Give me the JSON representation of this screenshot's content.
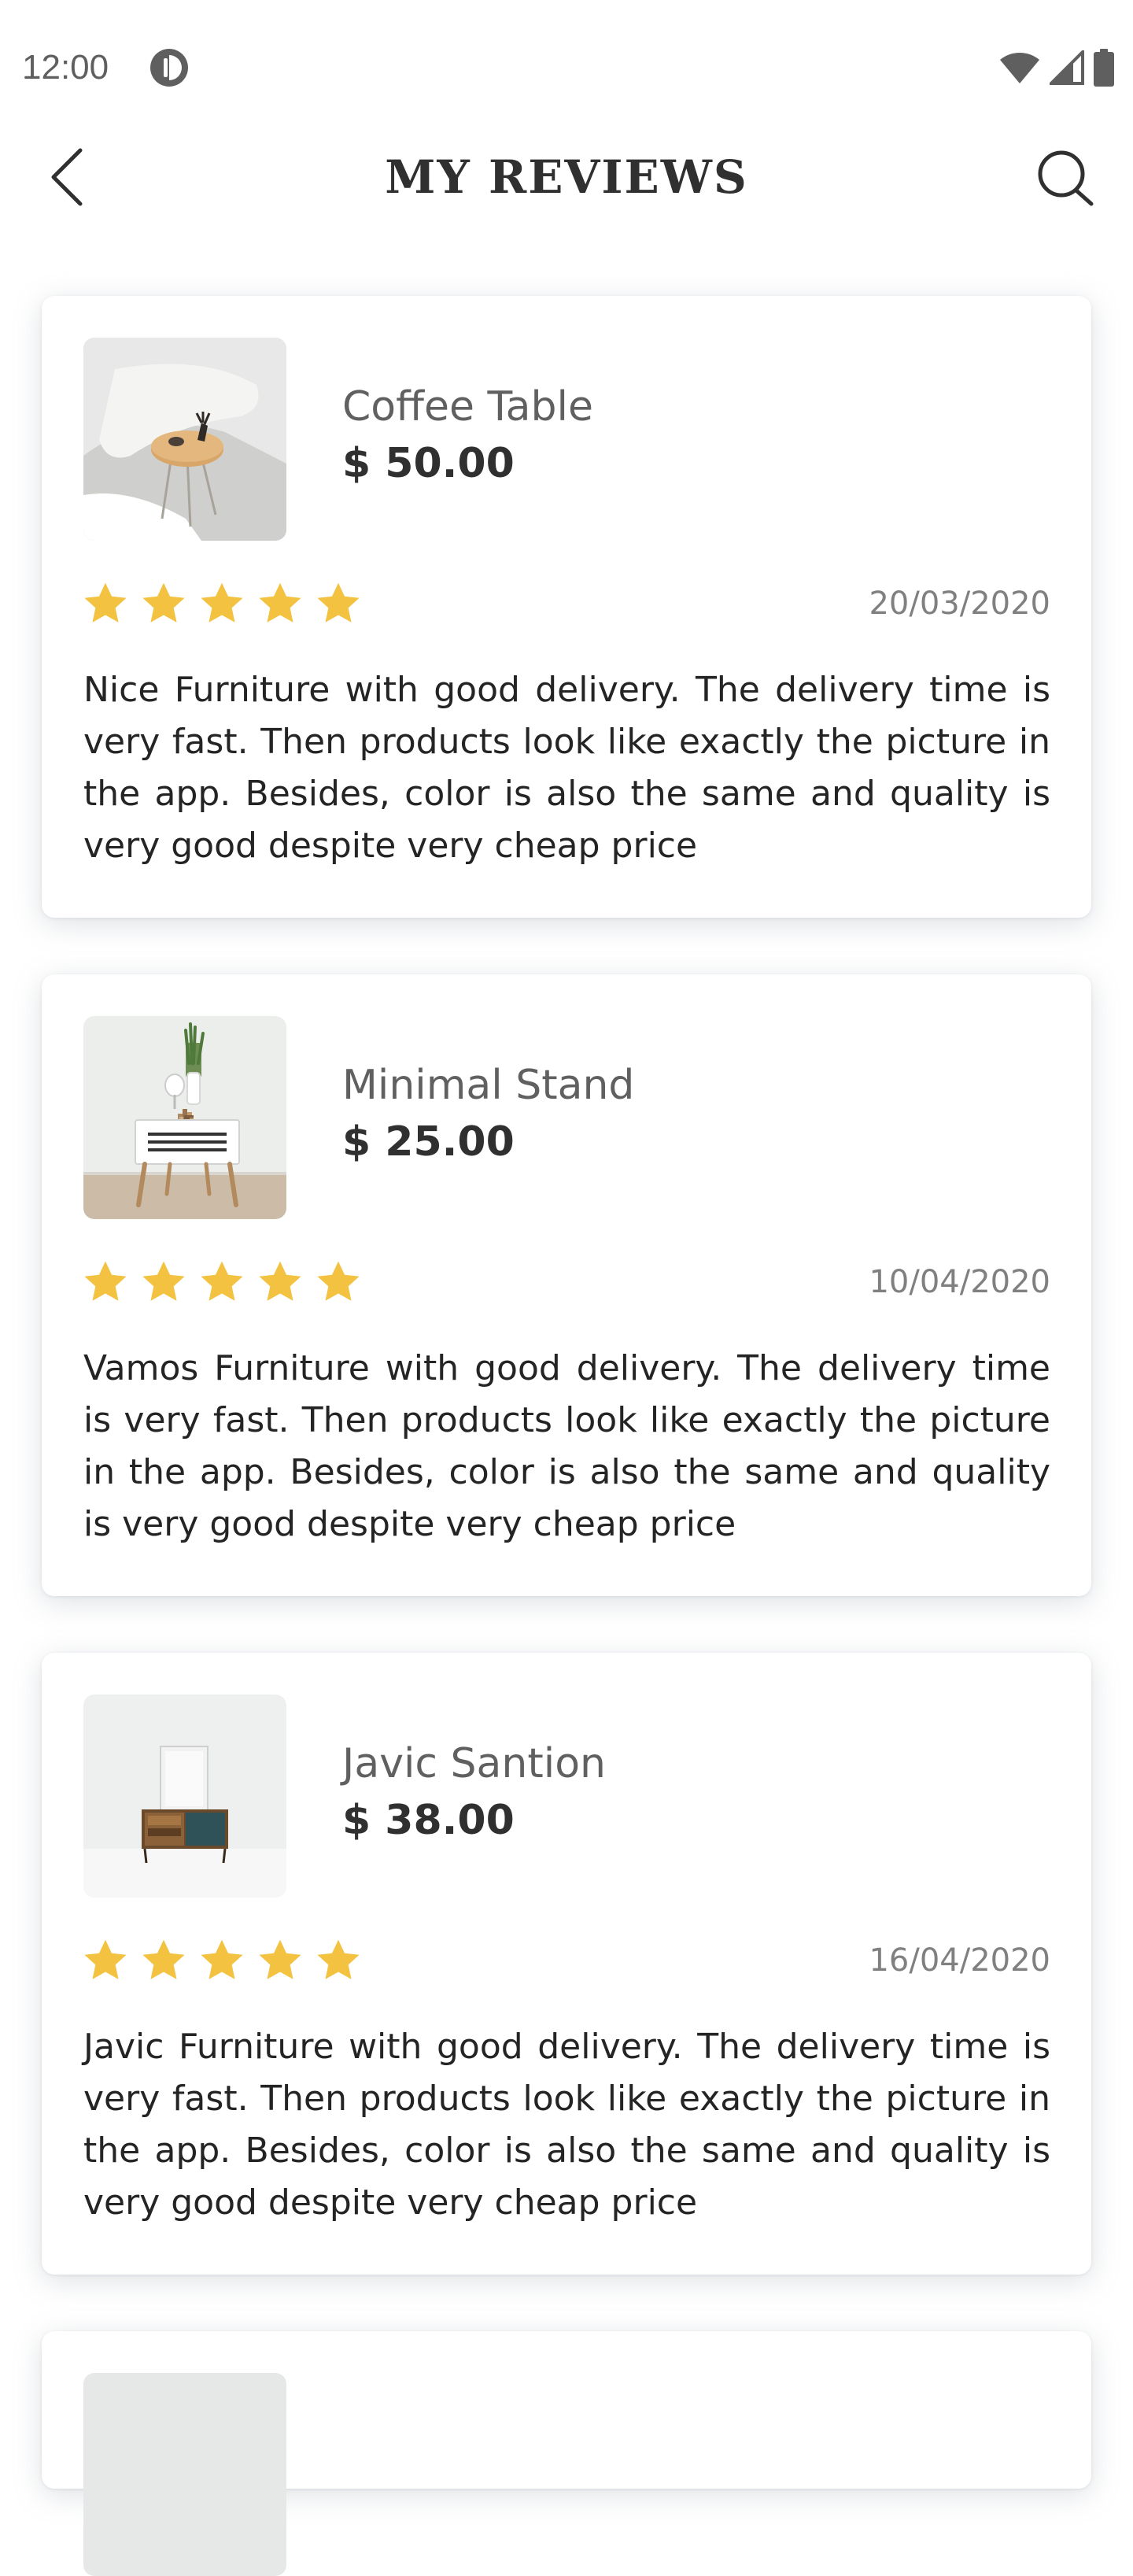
{
  "status_bar": {
    "time": "12:00",
    "icons": [
      "app-notification-icon",
      "wifi-icon",
      "cellular-signal-icon",
      "battery-icon"
    ]
  },
  "header": {
    "title": "MY REVIEWS",
    "back_icon": "chevron-left-icon",
    "search_icon": "search-icon"
  },
  "colors": {
    "star": "#F2C240",
    "title": "#303030",
    "muted": "#808080"
  },
  "reviews": [
    {
      "product_name": "Coffee Table",
      "price": "$ 50.00",
      "rating": 5,
      "date": "20/03/2020",
      "text": "Nice Furniture with good delivery. The delivery time is very fast. Then products look like exactly the picture in the app. Besides, color is also the same and quality is very good despite very cheap price"
    },
    {
      "product_name": "Minimal Stand",
      "price": "$ 25.00",
      "rating": 5,
      "date": "10/04/2020",
      "text": "Vamos Furniture with good delivery. The delivery time is very fast. Then products look like exactly the picture in the app. Besides, color is also the same and quality is very good despite very cheap price"
    },
    {
      "product_name": "Javic Santion",
      "price": "$ 38.00",
      "rating": 5,
      "date": "16/04/2020",
      "text": "Javic Furniture with good delivery. The delivery time is very fast. Then products look like exactly the picture in the app. Besides, color is also the same and quality is very good despite very cheap price"
    }
  ]
}
